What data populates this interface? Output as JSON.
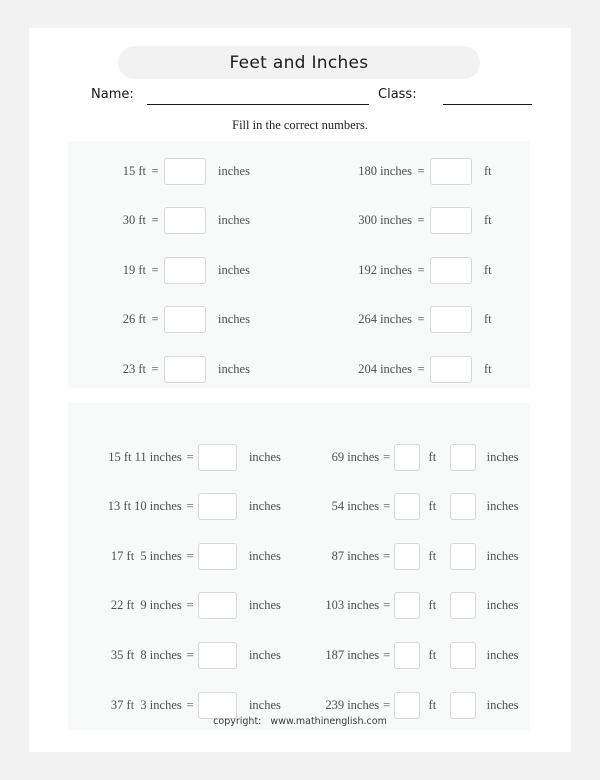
{
  "title": "Feet and Inches",
  "fields": {
    "name_label": "Name:",
    "class_label": "Class:"
  },
  "instruction": "Fill in the correct numbers.",
  "section1": {
    "left": [
      {
        "question": "15 ft",
        "equals": "=",
        "unit": "inches"
      },
      {
        "question": "30 ft",
        "equals": "=",
        "unit": "inches"
      },
      {
        "question": "19 ft",
        "equals": "=",
        "unit": "inches"
      },
      {
        "question": "26 ft",
        "equals": "=",
        "unit": "inches"
      },
      {
        "question": "23 ft",
        "equals": "=",
        "unit": "inches"
      }
    ],
    "right": [
      {
        "question": "180 inches",
        "equals": "=",
        "unit": "ft"
      },
      {
        "question": "300 inches",
        "equals": "=",
        "unit": "ft"
      },
      {
        "question": "192 inches",
        "equals": "=",
        "unit": "ft"
      },
      {
        "question": "264 inches",
        "equals": "=",
        "unit": "ft"
      },
      {
        "question": "204 inches",
        "equals": "=",
        "unit": "ft"
      }
    ]
  },
  "section2": {
    "left": [
      {
        "question": "15 ft 11 inches",
        "equals": "=",
        "unit": "inches"
      },
      {
        "question": "13 ft 10 inches",
        "equals": "=",
        "unit": "inches"
      },
      {
        "question": "17 ft  5 inches",
        "equals": "=",
        "unit": "inches"
      },
      {
        "question": "22 ft  9 inches",
        "equals": "=",
        "unit": "inches"
      },
      {
        "question": "35 ft  8 inches",
        "equals": "=",
        "unit": "inches"
      },
      {
        "question": "37 ft  3 inches",
        "equals": "=",
        "unit": "inches"
      }
    ],
    "right": [
      {
        "question": "69 inches",
        "equals": "=",
        "unit_mid": "ft",
        "unit_end": "inches"
      },
      {
        "question": "54 inches",
        "equals": "=",
        "unit_mid": "ft",
        "unit_end": "inches"
      },
      {
        "question": "87 inches",
        "equals": "=",
        "unit_mid": "ft",
        "unit_end": "inches"
      },
      {
        "question": "103 inches",
        "equals": "=",
        "unit_mid": "ft",
        "unit_end": "inches"
      },
      {
        "question": "187 inches",
        "equals": "=",
        "unit_mid": "ft",
        "unit_end": "inches"
      },
      {
        "question": "239 inches",
        "equals": "=",
        "unit_mid": "ft",
        "unit_end": "inches"
      }
    ]
  },
  "footer": "copyright:   www.mathinenglish.com"
}
